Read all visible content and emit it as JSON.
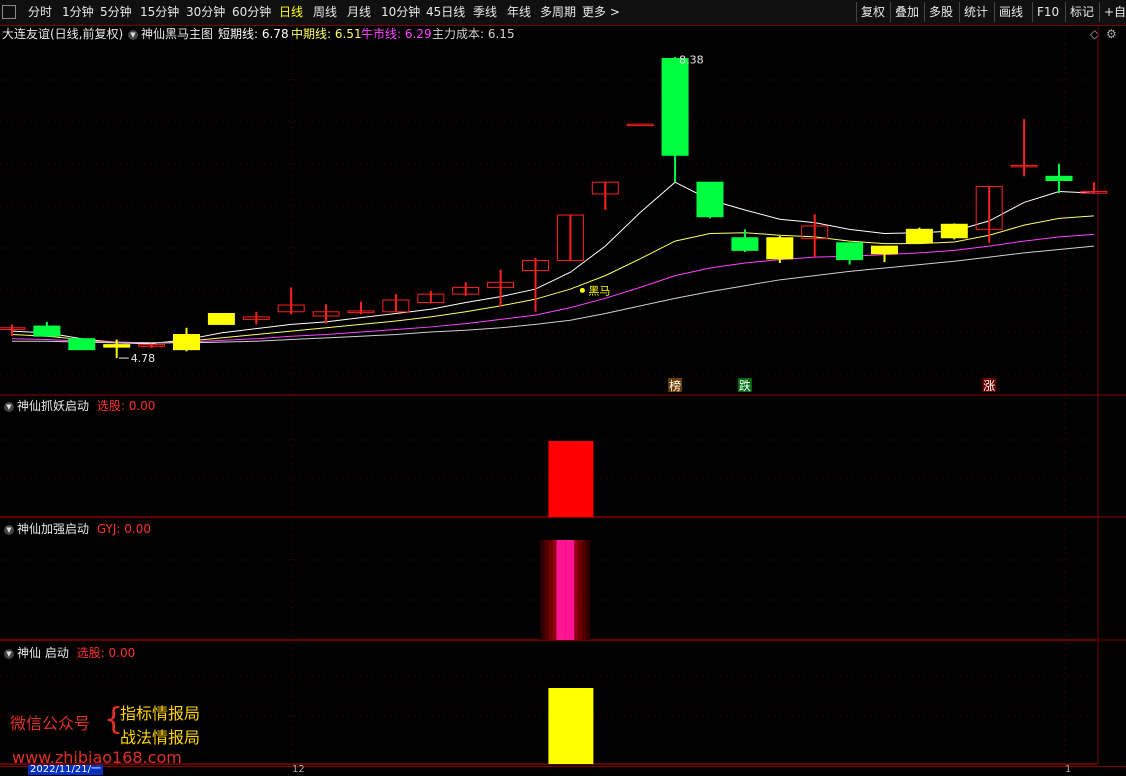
{
  "toolbar": {
    "periods": [
      "分时",
      "1分钟",
      "5分钟",
      "15分钟",
      "30分钟",
      "60分钟",
      "日线",
      "周线",
      "月线",
      "10分钟",
      "45日线",
      "季线",
      "年线",
      "多周期",
      "更多 >"
    ],
    "active_period": "日线",
    "right_buttons": [
      "复权",
      "叠加",
      "多股",
      "统计",
      "画线",
      "F10",
      "标记",
      "+自选"
    ]
  },
  "main": {
    "stock": "大连友谊(日线,前复权)",
    "indicator": "神仙黑马主图",
    "short_label": "短期线: 6.78",
    "mid_label": "中期线: 6.51",
    "bull_label": "牛市线: 6.29",
    "cost_label": "主力成本: 6.15",
    "high_label": "8.38",
    "low_label": "4.78",
    "heima_label": "黑马",
    "markers": [
      "榜",
      "跌",
      "涨"
    ],
    "colors": {
      "short": "#ffffff",
      "mid": "#ffff66",
      "bull": "#ff44ff",
      "cost": "#d0d0d0",
      "up": "#ff2020",
      "down": "#00ff40",
      "special": "#ffff00"
    }
  },
  "panels": [
    {
      "name": "神仙抓妖启动",
      "label": "选股: 0.00",
      "color": "#ff0000"
    },
    {
      "name": "神仙加强启动",
      "label": "GYJ: 0.00",
      "color": "#ff1493"
    },
    {
      "name": "神仙 启动",
      "label": "选股: 0.00",
      "color": "#ffff00"
    }
  ],
  "watermark": {
    "account": "微信公众号",
    "line1": "指标情报局",
    "line2": "战法情报局",
    "url": "www.zhibiao168.com"
  },
  "axis": {
    "date": "2022/11/21/一",
    "month_mark": "12",
    "right_mark": "1"
  },
  "chart_data": {
    "type": "candlestick",
    "candles": [
      {
        "o": 5.18,
        "h": 5.22,
        "l": 5.08,
        "c": 5.16,
        "color": "up"
      },
      {
        "o": 5.2,
        "h": 5.25,
        "l": 5.08,
        "c": 5.08,
        "color": "down"
      },
      {
        "o": 5.05,
        "h": 5.05,
        "l": 4.92,
        "c": 4.92,
        "color": "down"
      },
      {
        "o": 4.98,
        "h": 5.04,
        "l": 4.82,
        "c": 4.95,
        "color": "special"
      },
      {
        "o": 4.98,
        "h": 4.99,
        "l": 4.94,
        "c": 4.96,
        "color": "up"
      },
      {
        "o": 4.92,
        "h": 5.18,
        "l": 4.9,
        "c": 5.1,
        "color": "special"
      },
      {
        "o": 5.22,
        "h": 5.35,
        "l": 5.22,
        "c": 5.35,
        "color": "special"
      },
      {
        "o": 5.28,
        "h": 5.37,
        "l": 5.22,
        "c": 5.31,
        "color": "up"
      },
      {
        "o": 5.37,
        "h": 5.66,
        "l": 5.34,
        "c": 5.45,
        "color": "up"
      },
      {
        "o": 5.32,
        "h": 5.46,
        "l": 5.23,
        "c": 5.37,
        "color": "up"
      },
      {
        "o": 5.36,
        "h": 5.49,
        "l": 5.34,
        "c": 5.38,
        "color": "up"
      },
      {
        "o": 5.37,
        "h": 5.58,
        "l": 5.37,
        "c": 5.51,
        "color": "up"
      },
      {
        "o": 5.48,
        "h": 5.62,
        "l": 5.47,
        "c": 5.58,
        "color": "up"
      },
      {
        "o": 5.58,
        "h": 5.72,
        "l": 5.56,
        "c": 5.66,
        "color": "up"
      },
      {
        "o": 5.66,
        "h": 5.87,
        "l": 5.43,
        "c": 5.72,
        "color": "up"
      },
      {
        "o": 5.86,
        "h": 6.01,
        "l": 5.37,
        "c": 5.98,
        "color": "up"
      },
      {
        "o": 5.98,
        "h": 6.52,
        "l": 5.98,
        "c": 6.52,
        "color": "up"
      },
      {
        "o": 6.77,
        "h": 6.91,
        "l": 6.58,
        "c": 6.91,
        "color": "up"
      },
      {
        "o": 7.6,
        "h": 7.6,
        "l": 7.6,
        "c": 7.6,
        "color": "up"
      },
      {
        "o": 8.38,
        "h": 8.4,
        "l": 6.91,
        "c": 7.23,
        "color": "down"
      },
      {
        "o": 6.91,
        "h": 6.91,
        "l": 6.48,
        "c": 6.5,
        "color": "down"
      },
      {
        "o": 6.25,
        "h": 6.35,
        "l": 6.08,
        "c": 6.1,
        "color": "down"
      },
      {
        "o": 6.0,
        "h": 6.27,
        "l": 5.95,
        "c": 6.25,
        "color": "special"
      },
      {
        "o": 6.39,
        "h": 6.53,
        "l": 6.02,
        "c": 6.24,
        "color": "up"
      },
      {
        "o": 6.19,
        "h": 6.19,
        "l": 5.93,
        "c": 5.99,
        "color": "down"
      },
      {
        "o": 6.06,
        "h": 6.15,
        "l": 5.96,
        "c": 6.15,
        "color": "special"
      },
      {
        "o": 6.19,
        "h": 6.37,
        "l": 6.19,
        "c": 6.35,
        "color": "special"
      },
      {
        "o": 6.25,
        "h": 6.42,
        "l": 6.23,
        "c": 6.41,
        "color": "special"
      },
      {
        "o": 6.35,
        "h": 6.86,
        "l": 6.19,
        "c": 6.86,
        "color": "up"
      },
      {
        "o": 7.11,
        "h": 7.66,
        "l": 6.98,
        "c": 7.11,
        "color": "up"
      },
      {
        "o": 6.98,
        "h": 7.13,
        "l": 6.78,
        "c": 6.93,
        "color": "down"
      },
      {
        "o": 6.8,
        "h": 6.91,
        "l": 6.78,
        "c": 6.78,
        "color": "up"
      }
    ],
    "ma_short": [
      5.14,
      5.12,
      5.05,
      5.0,
      4.99,
      5.04,
      5.12,
      5.17,
      5.22,
      5.25,
      5.3,
      5.35,
      5.4,
      5.48,
      5.55,
      5.64,
      5.84,
      6.15,
      6.55,
      6.91,
      6.7,
      6.58,
      6.47,
      6.43,
      6.35,
      6.3,
      6.31,
      6.33,
      6.45,
      6.67,
      6.8,
      6.78
    ],
    "ma_mid": [
      5.1,
      5.08,
      5.04,
      5.01,
      5.0,
      5.02,
      5.06,
      5.1,
      5.14,
      5.18,
      5.22,
      5.26,
      5.31,
      5.37,
      5.44,
      5.52,
      5.64,
      5.8,
      6.0,
      6.21,
      6.3,
      6.31,
      6.28,
      6.26,
      6.21,
      6.18,
      6.18,
      6.2,
      6.28,
      6.4,
      6.48,
      6.51
    ],
    "ma_bull": [
      5.05,
      5.04,
      5.02,
      5.01,
      5.0,
      5.01,
      5.03,
      5.05,
      5.08,
      5.1,
      5.13,
      5.16,
      5.19,
      5.23,
      5.28,
      5.33,
      5.42,
      5.53,
      5.66,
      5.8,
      5.89,
      5.95,
      5.99,
      6.02,
      6.03,
      6.05,
      6.07,
      6.1,
      6.15,
      6.21,
      6.26,
      6.29
    ],
    "ma_cost": [
      5.02,
      5.02,
      5.01,
      5.0,
      5.0,
      5.0,
      5.01,
      5.02,
      5.04,
      5.06,
      5.08,
      5.1,
      5.13,
      5.15,
      5.18,
      5.22,
      5.27,
      5.35,
      5.44,
      5.53,
      5.61,
      5.68,
      5.75,
      5.8,
      5.85,
      5.89,
      5.93,
      5.97,
      6.02,
      6.07,
      6.11,
      6.15
    ],
    "ylim": [
      4.5,
      8.6
    ],
    "signal_index": 16
  }
}
